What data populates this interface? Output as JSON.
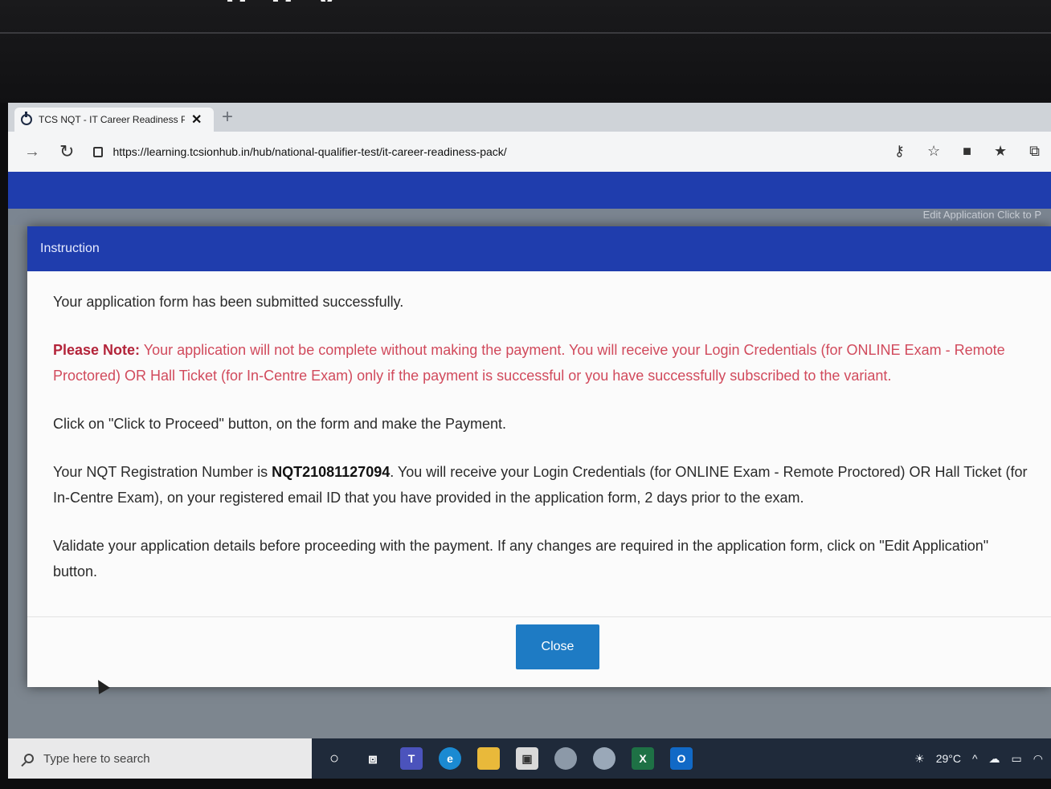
{
  "photo_overlay": {
    "cut_text": "ppy"
  },
  "browser": {
    "tab_title": "TCS NQT - IT Career Readiness P",
    "tab_close": "✕",
    "new_tab": "+",
    "url": "https://learning.tcsionhub.in/hub/national-qualifier-test/it-career-readiness-pack/",
    "icons": [
      "back-icon",
      "reload-icon",
      "lock-icon",
      "key-icon",
      "favorites-add-icon",
      "extension-icon",
      "favorites-icon",
      "collections-icon"
    ]
  },
  "page": {
    "bg_link": "Edit Application   Click to P"
  },
  "modal": {
    "title": "Instruction",
    "line1": "Your application form has been submitted successfully.",
    "note_label": "Please Note:",
    "note_text": " Your application will not be complete without making the payment. You will receive your Login Credentials (for ONLINE Exam - Remote Proctored) OR Hall Ticket (for In-Centre Exam) only if the payment is successful or you have successfully subscribed to the variant.",
    "line3": "Click on \"Click to Proceed\" button, on the form and make the Payment.",
    "reg_prefix": "Your NQT Registration Number is ",
    "reg_number": "NQT21081127094",
    "reg_suffix": ". You will receive your Login Credentials (for ONLINE Exam - Remote Proctored) OR Hall Ticket (for In-Centre Exam), on your registered email ID that you have provided in the application form, 2 days prior to the exam.",
    "line5": "Validate your application details before proceeding with the payment. If any changes are required in the application form, click on \"Edit Application\" button.",
    "close_label": "Close"
  },
  "taskbar": {
    "search_placeholder": "Type here to search",
    "weather": "29°C",
    "apps": [
      "cortana-icon",
      "task-view-icon",
      "teams-icon",
      "edge-icon",
      "file-explorer-icon",
      "store-icon",
      "app-icon",
      "app-icon",
      "excel-icon",
      "outlook-icon"
    ],
    "colors": {
      "taskbar": "#1f2a3a",
      "accent": "#1f3dad",
      "button": "#1e7bc4",
      "note": "#d14a5c"
    }
  }
}
